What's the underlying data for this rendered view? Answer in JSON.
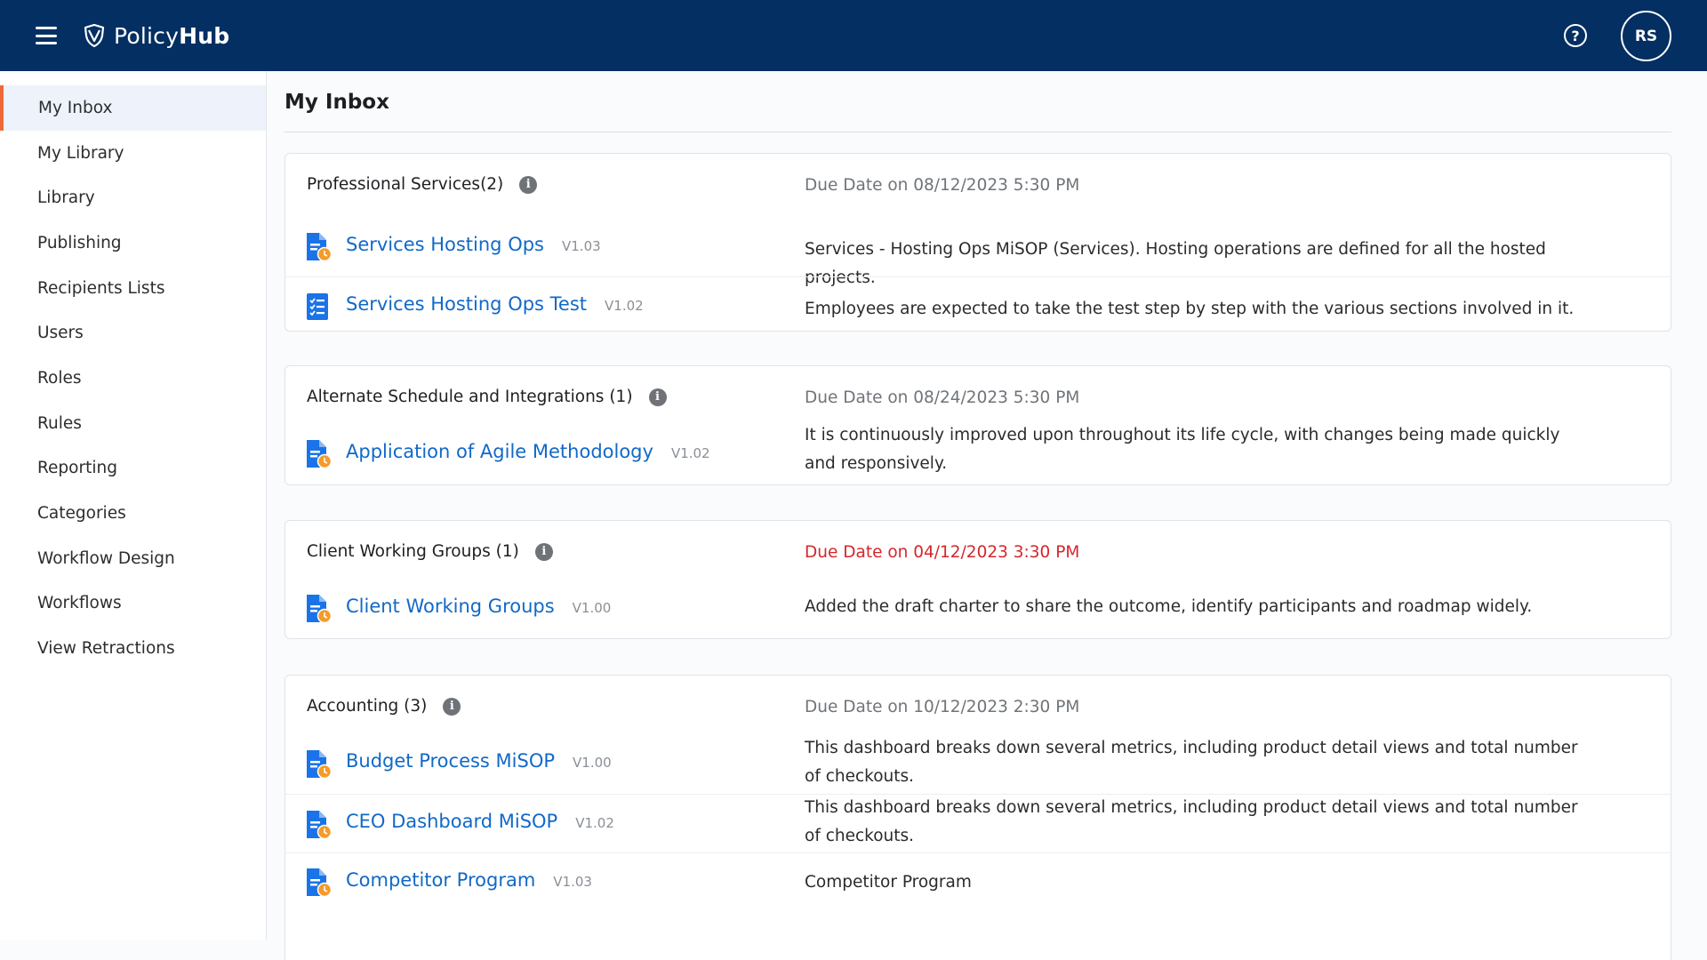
{
  "app": {
    "name_light": "Policy",
    "name_bold": "Hub",
    "user_initials": "RS",
    "help_label": "?"
  },
  "colors": {
    "topbar": "#032f62",
    "accent": "#ef6a3a",
    "link": "#1169c8",
    "overdue": "#d6262c"
  },
  "sidebar": {
    "items": [
      {
        "label": "My Inbox",
        "active": true
      },
      {
        "label": "My Library"
      },
      {
        "label": "Library"
      },
      {
        "label": "Publishing"
      },
      {
        "label": "Recipients Lists"
      },
      {
        "label": "Users"
      },
      {
        "label": "Roles"
      },
      {
        "label": "Rules"
      },
      {
        "label": "Reporting"
      },
      {
        "label": "Categories"
      },
      {
        "label": "Workflow Design"
      },
      {
        "label": "Workflows"
      },
      {
        "label": "View Retractions"
      }
    ]
  },
  "main": {
    "title": "My Inbox",
    "groups": [
      {
        "name": "Professional Services(2)",
        "due": "Due Date on 08/12/2023 5:30 PM",
        "overdue": false,
        "items": [
          {
            "title": "Services Hosting Ops",
            "version": "V1.03",
            "icon": "document-clock-icon",
            "description": "Services - Hosting Ops MiSOP (Services). Hosting operations are defined for all the hosted projects."
          },
          {
            "title": "Services Hosting Ops Test",
            "version": "V1.02",
            "icon": "checklist-icon",
            "description": "Employees are expected to take the test step by step with the various sections involved in it."
          }
        ]
      },
      {
        "name": "Alternate Schedule and Integrations (1)",
        "due": "Due Date on 08/24/2023 5:30 PM",
        "overdue": false,
        "items": [
          {
            "title": "Application of Agile Methodology",
            "version": "V1.02",
            "icon": "document-clock-icon",
            "description": "It is continuously improved upon throughout its life cycle, with changes being made quickly and responsively."
          }
        ]
      },
      {
        "name": "Client Working Groups (1)",
        "due": "Due Date on 04/12/2023 3:30 PM",
        "overdue": true,
        "items": [
          {
            "title": "Client Working Groups",
            "version": "V1.00",
            "icon": "document-clock-icon",
            "description": "Added the draft charter to share the outcome, identify participants and roadmap widely."
          }
        ]
      },
      {
        "name": "Accounting (3)",
        "due": "Due Date on 10/12/2023 2:30 PM",
        "overdue": false,
        "items": [
          {
            "title": "Budget Process MiSOP",
            "version": "V1.00",
            "icon": "document-clock-icon",
            "description": "This dashboard breaks down several metrics, including product detail views and total number of checkouts."
          },
          {
            "title": "CEO Dashboard MiSOP",
            "version": "V1.02",
            "icon": "document-clock-icon",
            "description": "This dashboard breaks down several metrics, including product detail views and total number of checkouts."
          },
          {
            "title": "Competitor Program",
            "version": "V1.03",
            "icon": "document-clock-icon",
            "description": "Competitor Program"
          }
        ]
      }
    ]
  }
}
